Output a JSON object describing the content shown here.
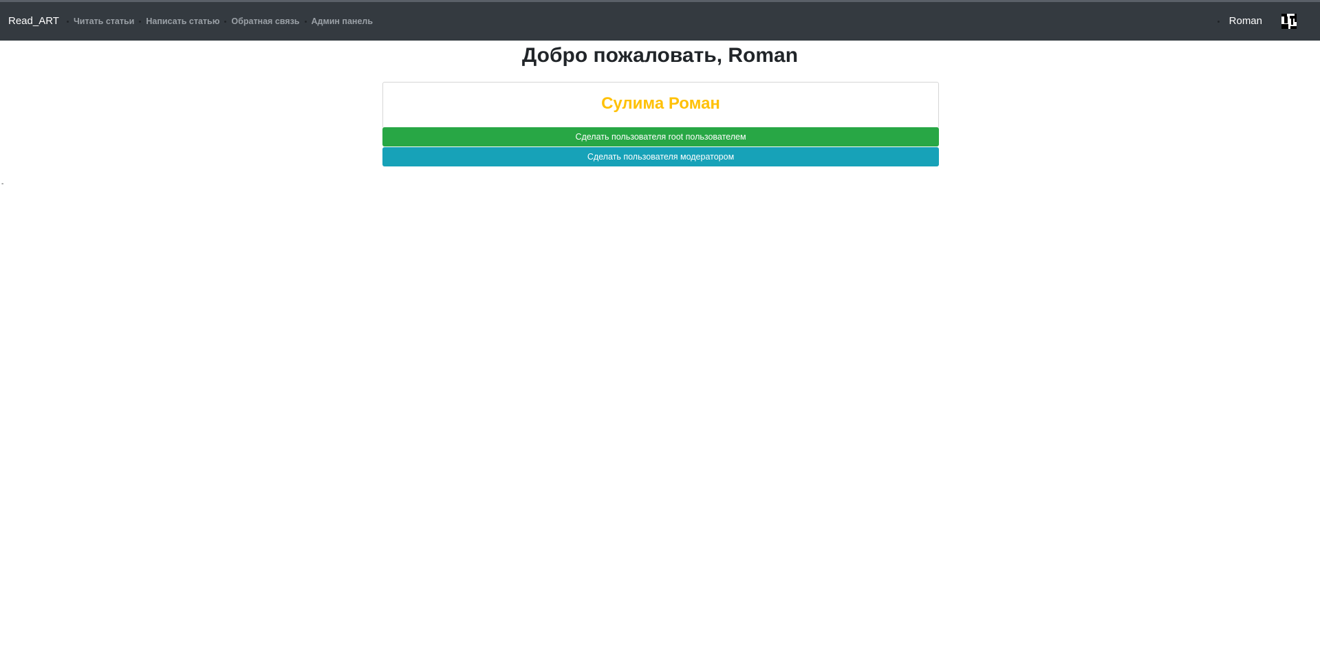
{
  "navbar": {
    "brand": "Read_ART",
    "links": [
      {
        "label": "Читать статьи"
      },
      {
        "label": "Написать статью"
      },
      {
        "label": "Обратная связь"
      },
      {
        "label": "Админ панель"
      }
    ],
    "user_name": "Roman"
  },
  "main": {
    "welcome": "Добро пожаловать, Roman",
    "profile_name": "Сулима Роман",
    "make_root_label": "Сделать пользователя root пользователем",
    "make_moderator_label": "Сделать пользователя модератором",
    "stray_mark": "-"
  },
  "colors": {
    "navbar_bg": "#343a40",
    "profile_name": "#ffc107",
    "root_button": "#28a745",
    "moderator_button": "#17a2b8"
  }
}
